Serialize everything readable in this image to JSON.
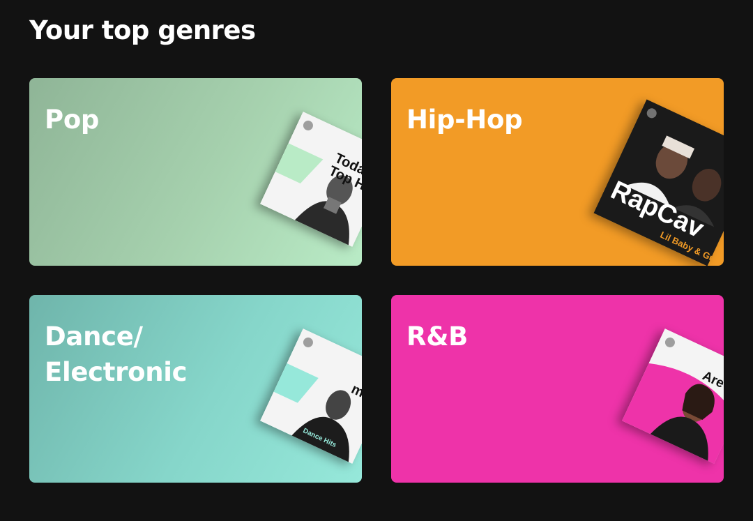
{
  "header": {
    "title": "Your top genres"
  },
  "genres": [
    {
      "title": "Pop",
      "cover_text": "Today's Top H",
      "color": "#a6d1ae"
    },
    {
      "title": "Hip-Hop",
      "cover_text": "RapCav",
      "cover_subtext": "Lil Baby & Gunna",
      "color": "#f29b26"
    },
    {
      "title": "Dance/\nElectronic",
      "cover_text": "min",
      "cover_subtext": "Dance Hits",
      "color": "#86d6ca"
    },
    {
      "title": "R&B",
      "cover_text": "Are &",
      "color": "#ee33a9"
    }
  ]
}
